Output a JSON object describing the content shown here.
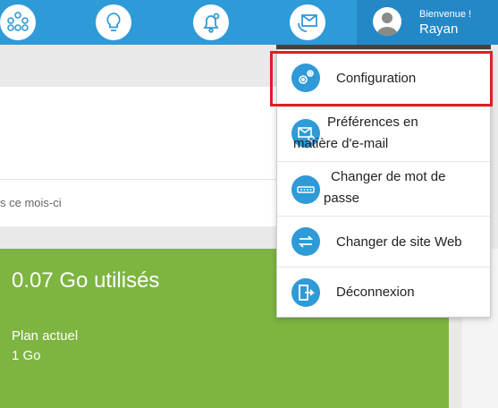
{
  "topbar": {
    "nav_icons": [
      "org-chart-icon",
      "lightbulb-icon",
      "bell-icon",
      "envelope-phone-icon"
    ],
    "user": {
      "welcome": "Bienvenue !",
      "name": "Rayan"
    }
  },
  "main": {
    "month_text": "s ce mois-ci",
    "usage_title": "0.07 Go utilisés",
    "plan_label": "Plan actuel",
    "plan_value": "1 Go",
    "usage_color": "#7db540"
  },
  "dropdown": {
    "items": [
      {
        "lines": [
          "Configuration"
        ],
        "icon": "gears-icon"
      },
      {
        "lines": [
          "Préférences en",
          "matière d'e-mail"
        ],
        "icon": "email-settings-icon"
      },
      {
        "lines": [
          "Changer de mot de",
          "passe"
        ],
        "icon": "password-icon"
      },
      {
        "lines": [
          "Changer de site Web"
        ],
        "icon": "swap-arrows-icon"
      },
      {
        "lines": [
          "Déconnexion"
        ],
        "icon": "logout-door-icon"
      }
    ]
  },
  "colors": {
    "accent": "#2f9ad8",
    "highlight": "#e01e25"
  }
}
